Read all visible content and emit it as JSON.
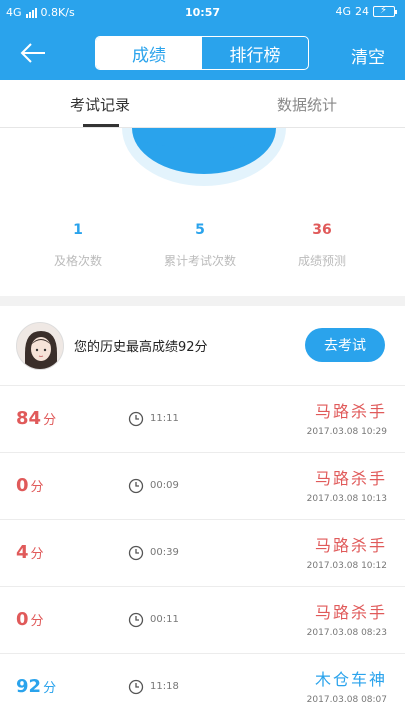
{
  "status_bar": {
    "network_left": "4G",
    "speed": "0.8K/s",
    "time": "10:57",
    "network_right": "4G",
    "signal": "24",
    "battery_icon": "battery-charging-icon"
  },
  "header": {
    "segments": [
      "成绩",
      "排行榜"
    ],
    "active_segment": 0,
    "clear_label": "清空",
    "back_icon": "back-arrow-icon"
  },
  "tabs": [
    {
      "label": "考试记录",
      "active": true
    },
    {
      "label": "数据统计",
      "active": false
    }
  ],
  "stats": [
    {
      "value": "1",
      "label": "及格次数",
      "color": "#2aa3ec"
    },
    {
      "value": "5",
      "label": "累计考试次数",
      "color": "#2aa3ec"
    },
    {
      "value": "36",
      "label": "成绩预测",
      "color": "#e05a5a"
    }
  ],
  "best": {
    "text": "您的历史最高成绩92分",
    "button_label": "去考试"
  },
  "records": [
    {
      "score": "84",
      "unit": "分",
      "duration": "11:11",
      "title": "马路杀手",
      "date": "2017.03.08   10:29",
      "score_color": "#e05a5a",
      "title_color": "#e05a5a"
    },
    {
      "score": "0",
      "unit": "分",
      "duration": "00:09",
      "title": "马路杀手",
      "date": "2017.03.08   10:13",
      "score_color": "#e05a5a",
      "title_color": "#e05a5a"
    },
    {
      "score": "4",
      "unit": "分",
      "duration": "00:39",
      "title": "马路杀手",
      "date": "2017.03.08   10:12",
      "score_color": "#e05a5a",
      "title_color": "#e05a5a"
    },
    {
      "score": "0",
      "unit": "分",
      "duration": "00:11",
      "title": "马路杀手",
      "date": "2017.03.08   08:23",
      "score_color": "#e05a5a",
      "title_color": "#e05a5a"
    },
    {
      "score": "92",
      "unit": "分",
      "duration": "11:18",
      "title": "木仓车神",
      "date": "2017.03.08   08:07",
      "score_color": "#2aa3ec",
      "title_color": "#2aa3ec"
    }
  ],
  "colors": {
    "primary": "#2aa3ec",
    "fail": "#e05a5a"
  }
}
